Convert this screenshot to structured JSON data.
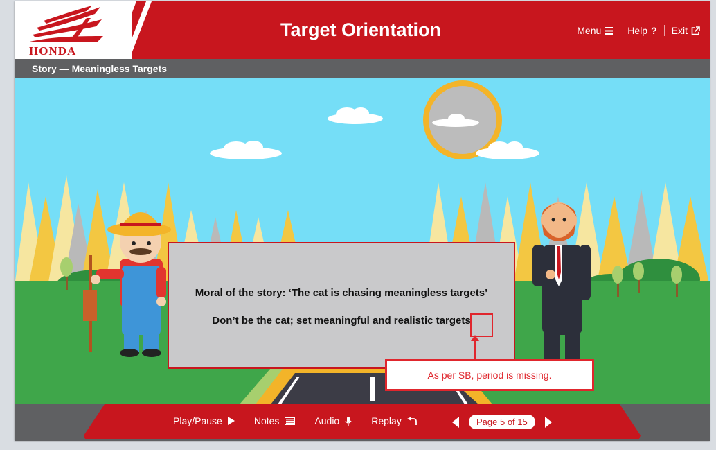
{
  "header": {
    "brand": "HONDA",
    "title": "Target Orientation",
    "nav": {
      "menu": "Menu",
      "help": "Help",
      "exit": "Exit"
    }
  },
  "subheader": {
    "title": "Story — Meaningless Targets"
  },
  "dialog": {
    "moral": "Moral of the story: ‘The cat is chasing meaningless targets’",
    "advice": "Don’t be the cat; set meaningful and realistic targets"
  },
  "review": {
    "comment": "As per SB, period is missing."
  },
  "footer": {
    "play_pause": "Play/Pause",
    "notes": "Notes",
    "audio": "Audio",
    "replay": "Replay",
    "page_indicator": "Page 5 of 15"
  },
  "icons": {
    "menu": "hamburger-icon",
    "help": "question-icon",
    "exit": "external-link-icon",
    "play": "play-icon",
    "notes": "keyboard-icon",
    "audio": "microphone-icon",
    "replay": "replay-icon"
  },
  "colors": {
    "brand_red": "#c8161e",
    "bar_gray": "#5f6062",
    "sky": "#75def7",
    "grass": "#3fa64a",
    "review_red": "#e0262d"
  }
}
